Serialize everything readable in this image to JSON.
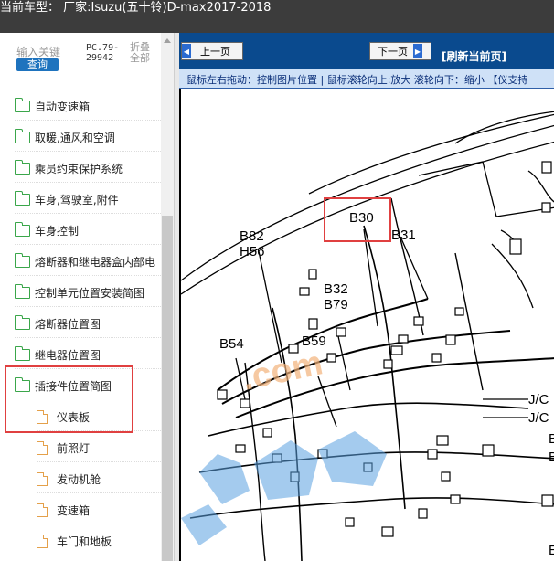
{
  "header": {
    "title": "当前车型： 厂家:Isuzu(五十铃)D-max2017-2018"
  },
  "search": {
    "keyword_label": "输入关键",
    "query_button": "查询",
    "code": "PC.79-29942",
    "collapse_all": "折叠全部"
  },
  "tree": {
    "folders": [
      {
        "label": "自动变速箱"
      },
      {
        "label": "取暖,通风和空调"
      },
      {
        "label": "乘员约束保护系统"
      },
      {
        "label": "车身,驾驶室,附件"
      },
      {
        "label": "车身控制"
      },
      {
        "label": "熔断器和继电器盒内部电"
      },
      {
        "label": "控制单元位置安装简图"
      },
      {
        "label": "熔断器位置图"
      },
      {
        "label": "继电器位置图"
      },
      {
        "label": "插接件位置简图"
      }
    ],
    "children": [
      {
        "label": "仪表板"
      },
      {
        "label": "前照灯"
      },
      {
        "label": "发动机舱"
      },
      {
        "label": "变速箱"
      },
      {
        "label": "车门和地板"
      }
    ]
  },
  "viewer": {
    "prev_button": "上一页",
    "next_button": "下一页",
    "refresh": "[刷新当前页]",
    "hint": "鼠标左右拖动：控制图片位置 | 鼠标滚轮向上:放大   滚轮向下：缩小 【仪支持"
  },
  "diagram": {
    "labels": [
      "B30",
      "B82",
      "H56",
      "B31",
      "B32",
      "B79",
      "B54",
      "B59",
      "J/C",
      "J/C",
      "B",
      "B",
      "E"
    ],
    "watermark": ".com"
  },
  "colors": {
    "highlight": "#e04040",
    "toolbar": "#0a4a8e",
    "topbar": "#3c3c3c",
    "query": "#1e73be"
  }
}
